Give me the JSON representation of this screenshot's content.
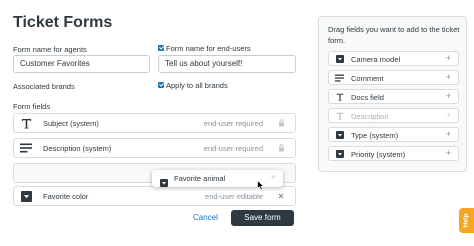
{
  "page_title": "Ticket Forms",
  "agent_name": {
    "label": "Form name for agents",
    "value": "Customer Favorites"
  },
  "enduser_name": {
    "label": "Form name for end-users",
    "value": "Tell us about yourself!"
  },
  "brands": {
    "label": "Associated brands",
    "apply_all_label": "Apply to all brands"
  },
  "form_fields_label": "Form fields",
  "fields": [
    {
      "name": "Subject (system)",
      "status": "end-user required",
      "icon": "text-icon",
      "action": "lock-icon"
    },
    {
      "name": "Description (system)",
      "status": "end-user required",
      "icon": "paragraph-icon",
      "action": "lock-icon"
    },
    {
      "name": "Favorite color",
      "status": "end-user editable",
      "icon": "dropdown-icon",
      "action": "close-icon"
    }
  ],
  "dragging_item": {
    "name": "Favorite animal",
    "icon": "dropdown-icon",
    "plus": "+"
  },
  "buttons": {
    "cancel": "Cancel",
    "save": "Save form"
  },
  "panel": {
    "instructions": "Drag fields you want to add to the ticket form.",
    "items": [
      {
        "name": "Camera model",
        "icon": "dropdown-icon",
        "disabled": false,
        "plus": "+"
      },
      {
        "name": "Comment",
        "icon": "paragraph-icon",
        "disabled": false,
        "plus": "+"
      },
      {
        "name": "Docs field",
        "icon": "text-icon",
        "disabled": false,
        "plus": "+"
      },
      {
        "name": "Description",
        "icon": "text-icon",
        "disabled": true,
        "plus": "+"
      },
      {
        "name": "Type (system)",
        "icon": "dropdown-icon",
        "disabled": false,
        "plus": "+"
      },
      {
        "name": "Priority (system)",
        "icon": "dropdown-icon",
        "disabled": false,
        "plus": "+"
      }
    ]
  },
  "help_tab": "Help",
  "colors": {
    "accent": "#1f73b7",
    "dark": "#2f3941",
    "muted": "#87929d",
    "help": "#f5a623"
  }
}
